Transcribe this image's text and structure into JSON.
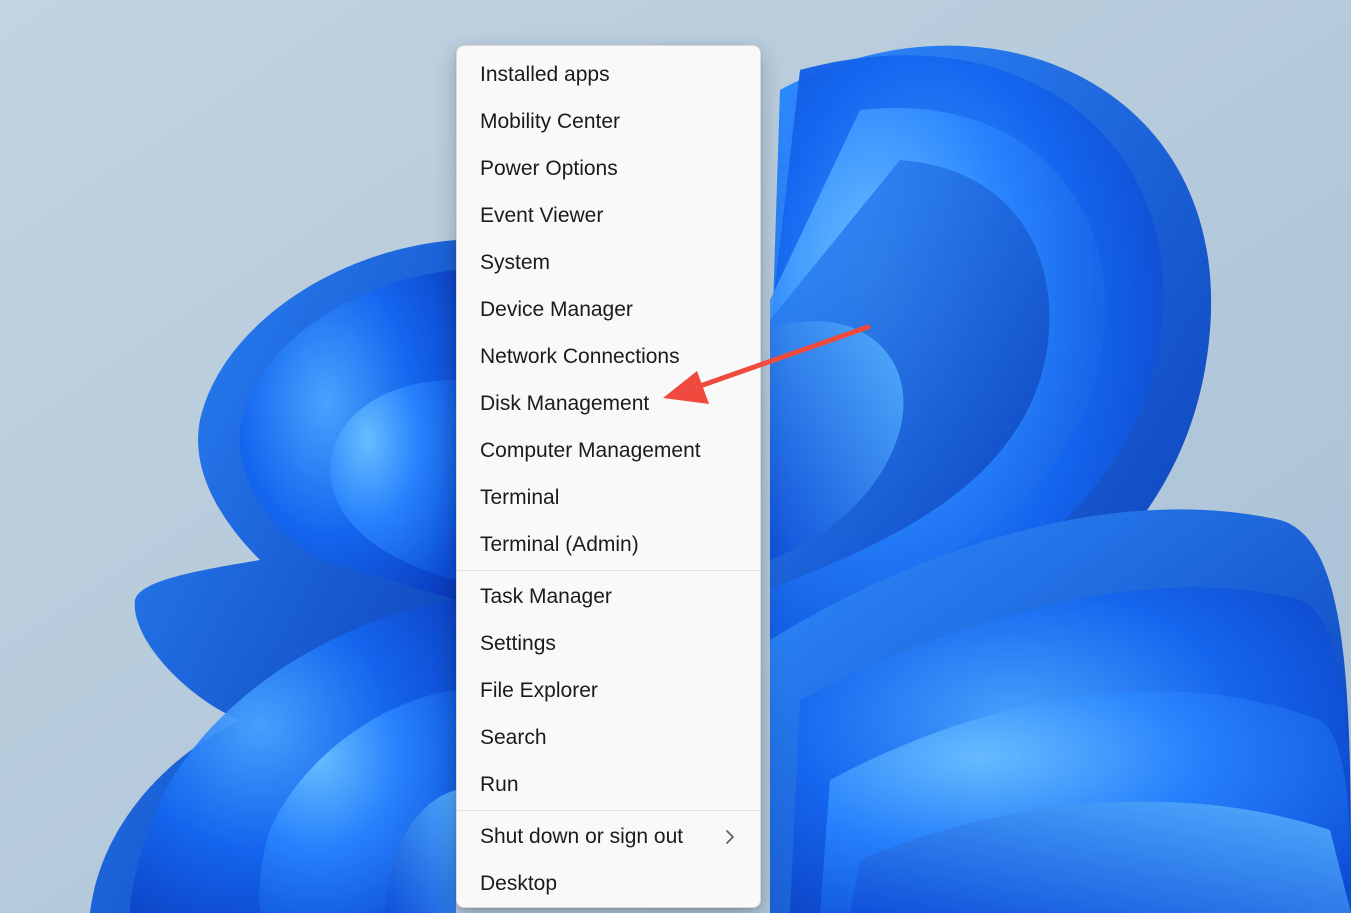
{
  "menu": {
    "groups": [
      {
        "items": [
          {
            "label": "Installed apps"
          },
          {
            "label": "Mobility Center"
          },
          {
            "label": "Power Options"
          },
          {
            "label": "Event Viewer"
          },
          {
            "label": "System"
          },
          {
            "label": "Device Manager"
          },
          {
            "label": "Network Connections"
          },
          {
            "label": "Disk Management"
          },
          {
            "label": "Computer Management"
          },
          {
            "label": "Terminal"
          },
          {
            "label": "Terminal (Admin)"
          }
        ]
      },
      {
        "items": [
          {
            "label": "Task Manager"
          },
          {
            "label": "Settings"
          },
          {
            "label": "File Explorer"
          },
          {
            "label": "Search"
          },
          {
            "label": "Run"
          }
        ]
      },
      {
        "items": [
          {
            "label": "Shut down or sign out",
            "submenu_icon": "chevron-right-icon"
          },
          {
            "label": "Desktop"
          }
        ]
      }
    ]
  },
  "annotation": {
    "color": "#f04a3e"
  },
  "colors": {
    "menu_background": "#f9f9f9",
    "menu_text": "#1b1b1b",
    "wallpaper_bloom": "#0a5ae8"
  }
}
